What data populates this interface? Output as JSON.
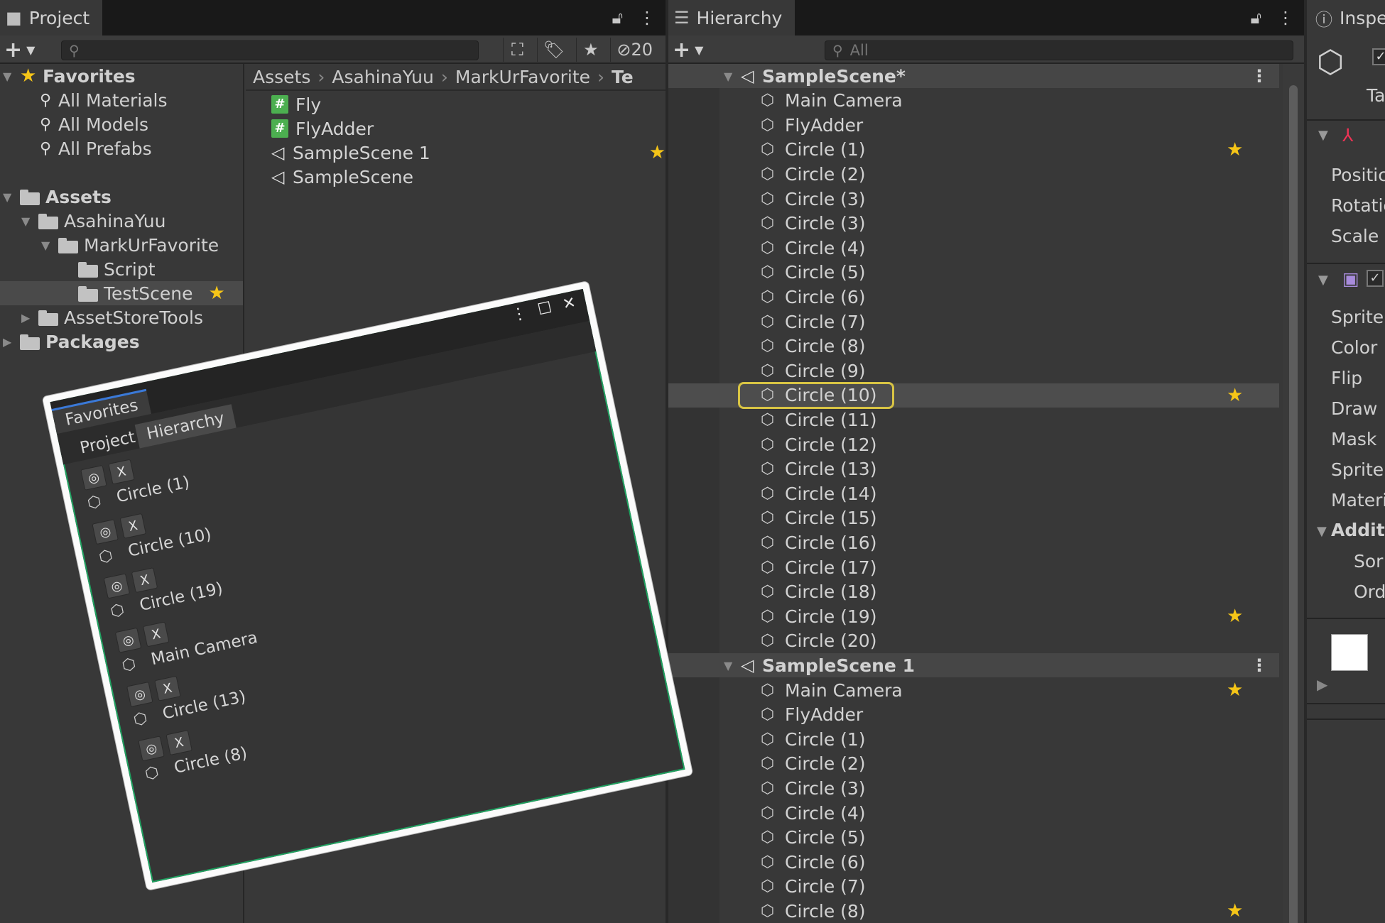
{
  "project": {
    "tab_title": "Project",
    "search_placeholder": "",
    "hidden_count": "20",
    "tree": {
      "favorites_label": "Favorites",
      "favorites": [
        "All Materials",
        "All Models",
        "All Prefabs"
      ],
      "assets_label": "Assets",
      "asahina": "AsahinaYuu",
      "markur": "MarkUrFavorite",
      "script": "Script",
      "testscene": "TestScene",
      "assetstore": "AssetStoreTools",
      "packages": "Packages"
    },
    "breadcrumb": [
      "Assets",
      "AsahinaYuu",
      "MarkUrFavorite",
      "Te"
    ],
    "files": [
      {
        "name": "Fly",
        "icon": "script-icon"
      },
      {
        "name": "FlyAdder",
        "icon": "script-icon"
      },
      {
        "name": "SampleScene 1",
        "icon": "unity-scene-icon"
      },
      {
        "name": "SampleScene",
        "icon": "unity-scene-icon"
      }
    ]
  },
  "hierarchy": {
    "tab_title": "Hierarchy",
    "search_placeholder": "All",
    "scene1": {
      "name": "SampleScene*",
      "items": [
        "Main Camera",
        "FlyAdder",
        "Circle (1)",
        "Circle (2)",
        "Circle (3)",
        "Circle (3)",
        "Circle (4)",
        "Circle (5)",
        "Circle (6)",
        "Circle (7)",
        "Circle (8)",
        "Circle (9)",
        "Circle (10)",
        "Circle (11)",
        "Circle (12)",
        "Circle (13)",
        "Circle (14)",
        "Circle (15)",
        "Circle (16)",
        "Circle (17)",
        "Circle (18)",
        "Circle (19)",
        "Circle (20)"
      ],
      "starred": [
        "Circle (1)",
        "Circle (10)",
        "Circle (19)"
      ],
      "selected": "Circle (10)"
    },
    "scene2": {
      "name": "SampleScene 1",
      "items": [
        "Main Camera",
        "FlyAdder",
        "Circle (1)",
        "Circle (2)",
        "Circle (3)",
        "Circle (4)",
        "Circle (5)",
        "Circle (6)",
        "Circle (7)",
        "Circle (8)"
      ],
      "starred": [
        "Main Camera",
        "Circle (8)"
      ]
    }
  },
  "inspector": {
    "tab_title": "Inspe",
    "rows": [
      "Ta",
      "Positic",
      "Rotatic",
      "Scale",
      "Sprite",
      "Color",
      "Flip",
      "Draw",
      "Mask",
      "Sprite",
      "Materi",
      "Additi",
      "Sor",
      "Ord"
    ]
  },
  "favorites_window": {
    "tab_title": "Favorites",
    "subtabs": [
      "Project",
      "Hierarchy"
    ],
    "items": [
      "Circle (1)",
      "Circle (10)",
      "Circle (19)",
      "Main Camera",
      "Circle (13)",
      "Circle (8)"
    ],
    "ping_glyph": "◎",
    "remove_glyph": "X"
  },
  "colors": {
    "star": "#f5c518",
    "selection_outline": "#d8c444",
    "window_border": "#1fa361"
  }
}
